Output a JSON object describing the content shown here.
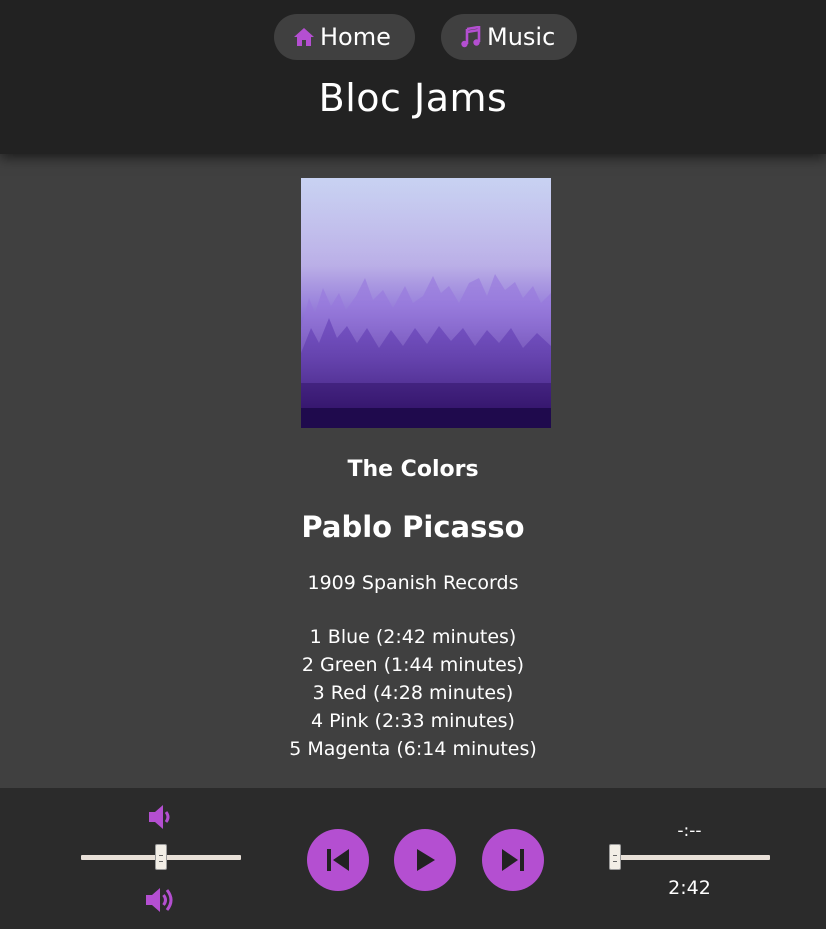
{
  "nav": {
    "home_label": "Home",
    "music_label": "Music",
    "home_icon": "home-icon",
    "music_icon": "music-note-icon",
    "accent_color": "#b44fd1"
  },
  "header": {
    "title": "Bloc Jams"
  },
  "album": {
    "title": "The Colors",
    "artist": "Pablo Picasso",
    "release_info": "1909 Spanish Records",
    "songs": [
      "1 Blue (2:42 minutes)",
      "2 Green (1:44 minutes)",
      "3 Red (4:28 minutes)",
      "4 Pink (2:33 minutes)",
      "5 Magenta (6:14 minutes)"
    ]
  },
  "player": {
    "current_time": "-:--",
    "total_time": "2:42",
    "volume_fraction": 0.5,
    "seek_fraction": 0.0,
    "controls": [
      "previous-icon",
      "play-icon",
      "next-icon"
    ],
    "volume_icons": [
      "volume-low-icon",
      "volume-high-icon"
    ]
  },
  "colors": {
    "header_bg": "#222222",
    "body_bg": "#404040",
    "player_bg": "#2b2b2b",
    "accent": "#b44fd1"
  }
}
